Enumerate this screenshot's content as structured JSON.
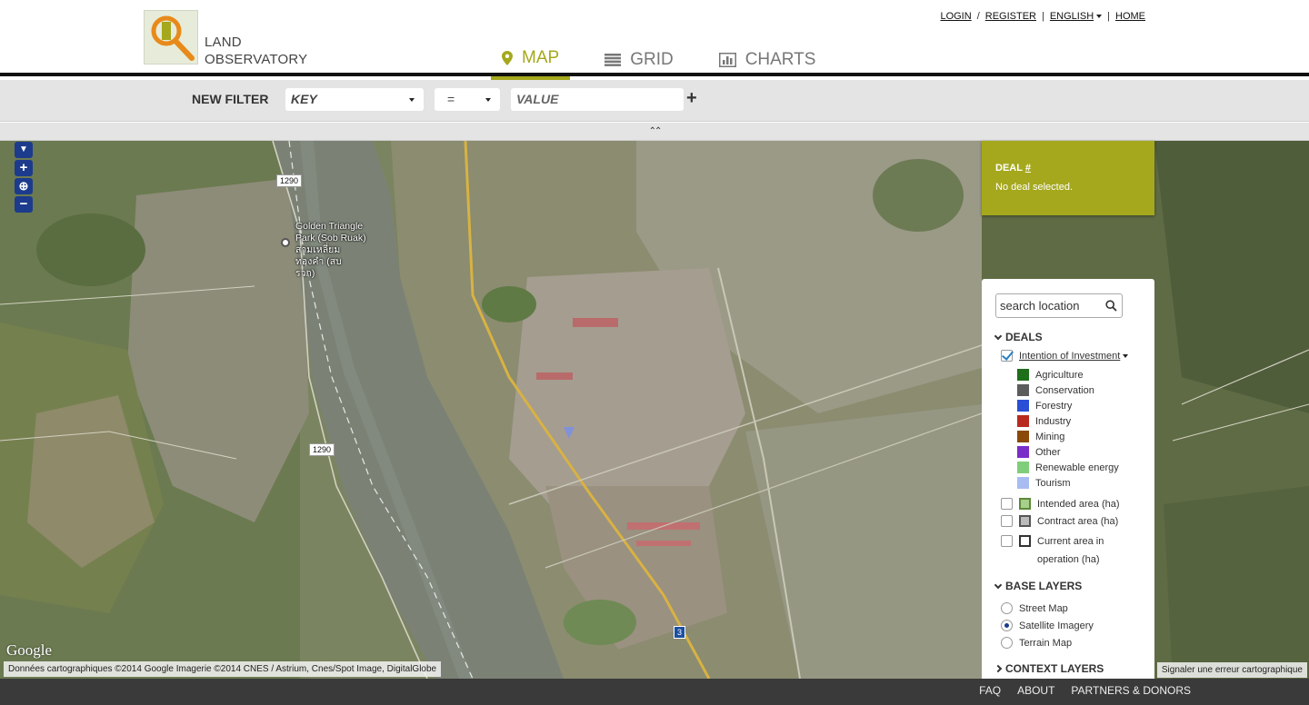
{
  "brand": {
    "line1": "LAND",
    "line2": "OBSERVATORY"
  },
  "top_links": {
    "login": "LOGIN",
    "register": "REGISTER",
    "language": "ENGLISH",
    "home": "HOME",
    "sep1": "/",
    "sep2": "|",
    "sep3": "|"
  },
  "nav": {
    "map": "MAP",
    "grid": "GRID",
    "charts": "CHARTS",
    "active": "map",
    "accent": "#a5a81c"
  },
  "filter": {
    "label": "NEW FILTER",
    "key": "KEY",
    "operator": "=",
    "value_placeholder": "VALUE",
    "add": "+"
  },
  "collapse": "⌃⌃",
  "map": {
    "roads": [
      "1290",
      "1290",
      "3"
    ],
    "place": "Golden Triangle Park (Sob Ruak)",
    "place_thai": "สามเหลี่ยม ทองคำ (สบรวก)",
    "google": "Google",
    "attribution": "Données cartographiques ©2014 Google Imagerie ©2014 CNES / Astrium, Cnes/Spot Image, DigitalGlobe",
    "report": "Signaler une erreur cartographique"
  },
  "deal_panel": {
    "title": "DEAL",
    "hash": "#",
    "status": "No deal selected."
  },
  "legend": {
    "search_placeholder": "search location",
    "deals_heading": "DEALS",
    "intention_label": "Intention of Investment",
    "categories": [
      {
        "label": "Agriculture",
        "color": "#1e6e1a"
      },
      {
        "label": "Conservation",
        "color": "#5c5c5c"
      },
      {
        "label": "Forestry",
        "color": "#2a4fd6"
      },
      {
        "label": "Industry",
        "color": "#b82a1e"
      },
      {
        "label": "Mining",
        "color": "#8a4a0a"
      },
      {
        "label": "Other",
        "color": "#7a2ec8"
      },
      {
        "label": "Renewable energy",
        "color": "#7fce7a"
      },
      {
        "label": "Tourism",
        "color": "#a8bcf2"
      }
    ],
    "areas": [
      {
        "label": "Intended area (ha)",
        "color": "#5c8a3a",
        "fill": "#a8d08a"
      },
      {
        "label": "Contract area (ha)",
        "color": "#555555",
        "fill": "#bbbbbb"
      },
      {
        "label": "Current area in operation (ha)",
        "color": "#4a6fd6",
        "fill": "#a8bcf2"
      }
    ],
    "base_heading": "BASE LAYERS",
    "base_layers": [
      "Street Map",
      "Satellite Imagery",
      "Terrain Map"
    ],
    "base_selected": "Satellite Imagery",
    "context_heading": "CONTEXT LAYERS"
  },
  "footer": {
    "faq": "FAQ",
    "about": "ABOUT",
    "partners": "PARTNERS & DONORS"
  }
}
